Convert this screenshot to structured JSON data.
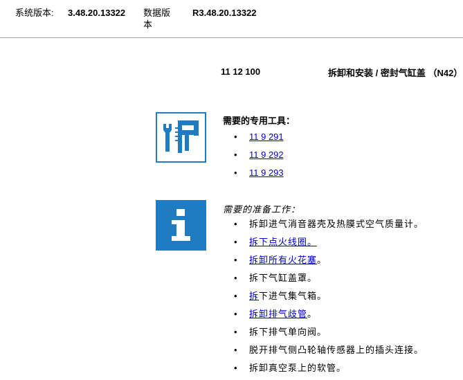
{
  "header": {
    "system_version_label": "系统版本:",
    "system_version_value": "3.48.20.13322",
    "data_version_label": "数据版本",
    "data_version_value": "R3.48.20.13322"
  },
  "document": {
    "number": "11 12 100",
    "title": "拆卸和安装 / 密封气缸盖 （N42）"
  },
  "icons": {
    "tools": "special-tools-icon",
    "info": "info-icon",
    "accent_color": "#1f7cc2"
  },
  "special_tools": {
    "heading": "需要的专用工具：",
    "items": [
      "11 9 291",
      "11 9 292",
      "11 9 293"
    ]
  },
  "preparation": {
    "heading": "需要的准备工作：",
    "items": [
      {
        "link": "",
        "text": "拆卸进气消音器壳及热膜式空气质量计。"
      },
      {
        "link": "拆下点火线圈。",
        "text": ""
      },
      {
        "link": "拆卸所有火花塞",
        "text": "。"
      },
      {
        "link": "",
        "text": "拆下气缸盖罩。"
      },
      {
        "link": "拆",
        "text": "下进气集气箱。"
      },
      {
        "link": "拆卸排气歧管",
        "text": "。"
      },
      {
        "link": "",
        "text": "拆下排气单向阀。"
      },
      {
        "link": "",
        "text": "脱开排气侧凸轮轴传感器上的插头连接。"
      },
      {
        "link": "",
        "text": "拆卸真空泵上的软管。"
      }
    ]
  }
}
